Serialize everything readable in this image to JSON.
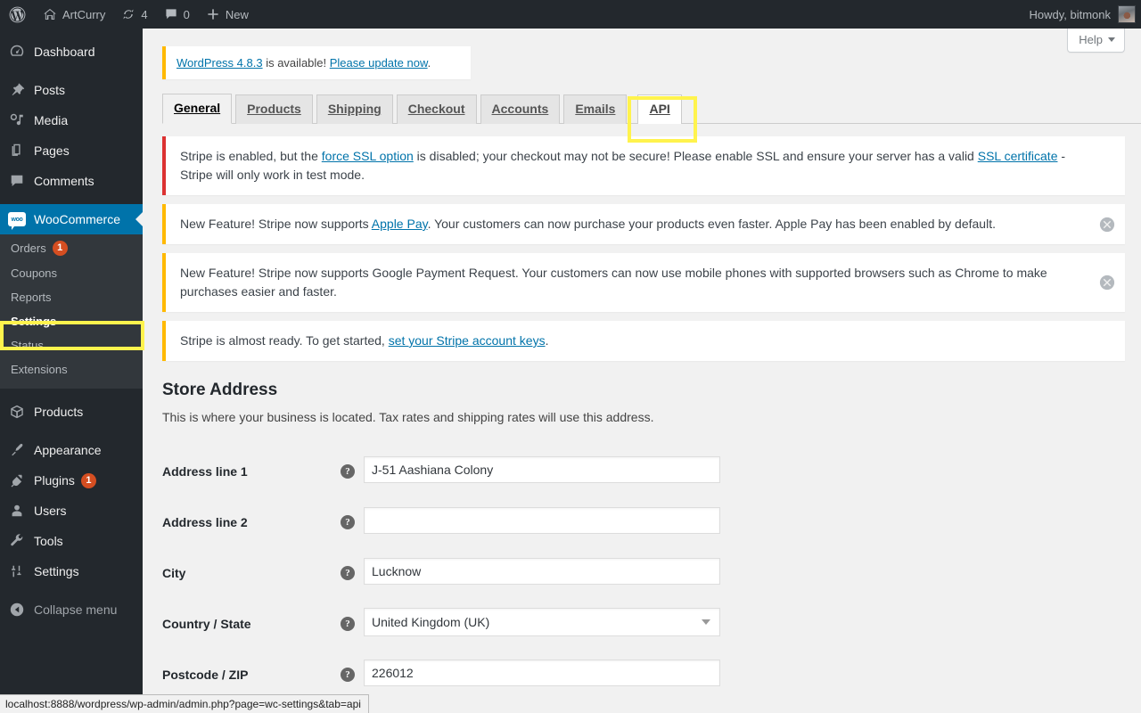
{
  "adminbar": {
    "wp_logo": "wordpress-logo-icon",
    "site_name": "ArtCurry",
    "updates_count": "4",
    "comments_count": "0",
    "new_label": "New",
    "howdy": "Howdy, bitmonk"
  },
  "sidebar": {
    "items": [
      {
        "label": "Dashboard",
        "icon": "dashboard-icon"
      },
      {
        "label": "Posts",
        "icon": "pin-icon"
      },
      {
        "label": "Media",
        "icon": "media-icon"
      },
      {
        "label": "Pages",
        "icon": "pages-icon"
      },
      {
        "label": "Comments",
        "icon": "comment-icon"
      }
    ],
    "woocommerce": {
      "label": "WooCommerce",
      "icon": "woocommerce-icon",
      "current": true
    },
    "submenu": [
      {
        "label": "Orders",
        "badge": "1"
      },
      {
        "label": "Coupons",
        "badge": ""
      },
      {
        "label": "Reports",
        "badge": ""
      },
      {
        "label": "Settings",
        "badge": "",
        "current": true
      },
      {
        "label": "Status",
        "badge": ""
      },
      {
        "label": "Extensions",
        "badge": ""
      }
    ],
    "items_bottom": [
      {
        "label": "Products",
        "icon": "products-icon",
        "badge": ""
      },
      {
        "label": "Appearance",
        "icon": "appearance-icon",
        "badge": ""
      },
      {
        "label": "Plugins",
        "icon": "plugins-icon",
        "badge": "1"
      },
      {
        "label": "Users",
        "icon": "users-icon",
        "badge": ""
      },
      {
        "label": "Tools",
        "icon": "tools-icon",
        "badge": ""
      },
      {
        "label": "Settings",
        "icon": "settings-icon",
        "badge": ""
      }
    ],
    "collapse_label": "Collapse menu"
  },
  "content": {
    "help_label": "Help",
    "wp_update_notice": {
      "link1": "WordPress 4.8.3",
      "mid": " is available! ",
      "link2": "Please update now",
      "end": "."
    },
    "tabs": [
      {
        "label": "General",
        "state": "active"
      },
      {
        "label": "Products",
        "state": "normal"
      },
      {
        "label": "Shipping",
        "state": "normal"
      },
      {
        "label": "Checkout",
        "state": "normal"
      },
      {
        "label": "Accounts",
        "state": "normal"
      },
      {
        "label": "Emails",
        "state": "normal"
      },
      {
        "label": "API",
        "state": "highlighted"
      }
    ],
    "notices": [
      {
        "type": "error",
        "parts": [
          {
            "t": "Stripe is enabled, but the "
          },
          {
            "t": "force SSL option",
            "link": true
          },
          {
            "t": " is disabled; your checkout may not be secure! Please enable SSL and ensure your server has a valid "
          },
          {
            "t": "SSL certificate",
            "link": true
          },
          {
            "t": " - Stripe will only work in test mode."
          }
        ],
        "dismissible": false
      },
      {
        "type": "warning",
        "parts": [
          {
            "t": "New Feature! Stripe now supports "
          },
          {
            "t": "Apple Pay",
            "link": true
          },
          {
            "t": ". Your customers can now purchase your products even faster. Apple Pay has been enabled by default."
          }
        ],
        "dismissible": true
      },
      {
        "type": "warning",
        "parts": [
          {
            "t": "New Feature! Stripe now supports Google Payment Request. Your customers can now use mobile phones with supported browsers such as Chrome to make purchases easier and faster."
          }
        ],
        "dismissible": true
      },
      {
        "type": "warning",
        "parts": [
          {
            "t": "Stripe is almost ready. To get started, "
          },
          {
            "t": "set your Stripe account keys",
            "link": true
          },
          {
            "t": "."
          }
        ],
        "dismissible": false
      }
    ],
    "store_address": {
      "title": "Store Address",
      "description": "This is where your business is located. Tax rates and shipping rates will use this address.",
      "fields": [
        {
          "label": "Address line 1",
          "value": "J-51 Aashiana Colony",
          "type": "text",
          "placeholder": ""
        },
        {
          "label": "Address line 2",
          "value": "",
          "type": "text",
          "placeholder": ""
        },
        {
          "label": "City",
          "value": "Lucknow",
          "type": "text",
          "placeholder": ""
        },
        {
          "label": "Country / State",
          "value": "United Kingdom (UK)",
          "type": "select",
          "placeholder": ""
        },
        {
          "label": "Postcode / ZIP",
          "value": "226012",
          "type": "text",
          "placeholder": ""
        }
      ]
    }
  },
  "statusbar": {
    "url": "localhost:8888/wordpress/wp-admin/admin.php?page=wc-settings&tab=api"
  },
  "colors": {
    "adminbar_bg": "#23282d",
    "sidebar_bg": "#23282d",
    "submenu_bg": "#32373c",
    "accent_blue": "#0073aa",
    "badge_orange": "#d54e21",
    "highlight_yellow": "#fff34d",
    "notice_warning": "#ffb900",
    "notice_error": "#dc3232"
  }
}
